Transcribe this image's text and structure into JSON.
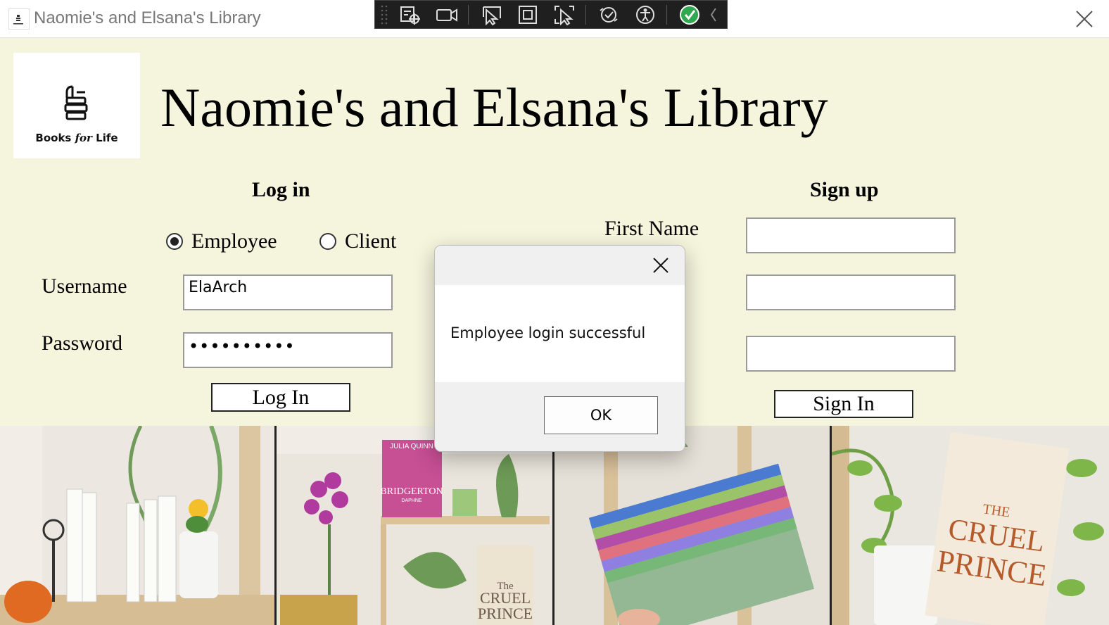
{
  "window": {
    "title": "Naomie's and Elsana's Library"
  },
  "debug_toolbar": {
    "tools": [
      "select-element-icon",
      "video-camera-icon",
      "pointer-select-icon",
      "frame-icon",
      "pointer-frame-icon",
      "hot-reload-icon",
      "accessibility-icon",
      "checkmark-icon",
      "collapse-chevron-icon"
    ]
  },
  "header": {
    "logo_text_pre": "Books ",
    "logo_text_for": "for",
    "logo_text_post": " Life",
    "title": "Naomie's and Elsana's Library"
  },
  "login": {
    "title": "Log in",
    "radio_employee": "Employee",
    "radio_client": "Client",
    "selected": "Employee",
    "username_label": "Username",
    "username_value": "ElaArch",
    "password_label": "Password",
    "password_value": "••••••••••",
    "button": "Log In"
  },
  "signup": {
    "title": "Sign up",
    "first_name_label": "First Name",
    "second_label_fragment": "e",
    "button": "Sign In"
  },
  "dialog": {
    "message": "Employee login successful",
    "ok": "OK"
  },
  "photos": {
    "book_1": "BRIDGERTON",
    "book_1_author": "JULIA QUINN",
    "book_1_sub": "DAPHNE",
    "book_2_a": "The",
    "book_2_b": "CRUEL",
    "book_2_c": "PRINCE",
    "book_3_a": "THE",
    "book_3_b": "CRUEL",
    "book_3_c": "PRINCE"
  },
  "colors": {
    "background": "#f5f4dc",
    "toolbar": "#1f1f1f",
    "check_green": "#2fa84f"
  }
}
